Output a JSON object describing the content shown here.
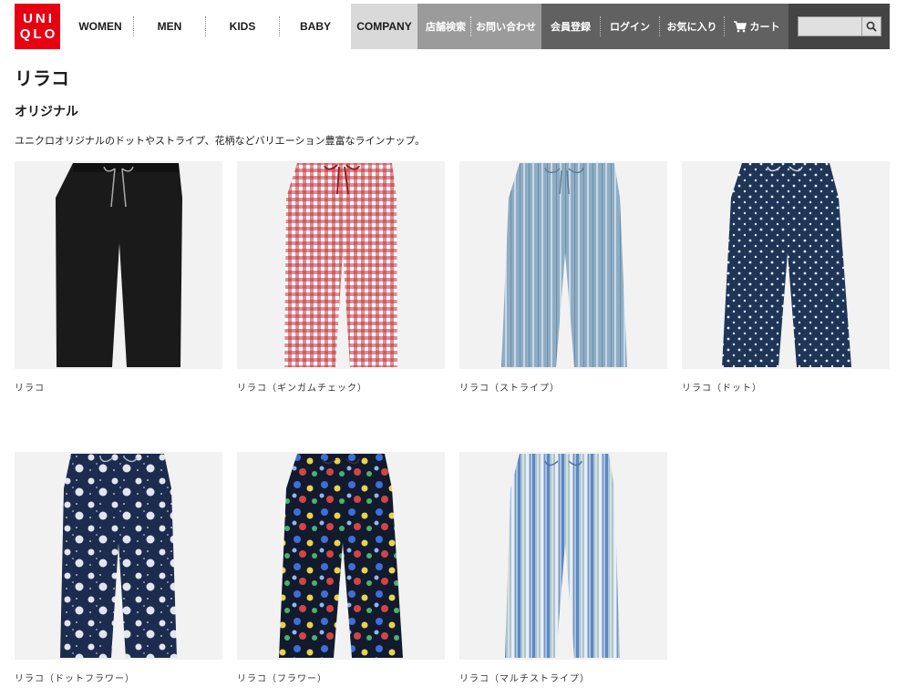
{
  "header": {
    "logo_line1": "UNI",
    "logo_line2": "QLO",
    "nav": {
      "women": "WOMEN",
      "men": "MEN",
      "kids": "KIDS",
      "baby": "BABY",
      "company": "COMPANY"
    },
    "store_search": "店舗検索",
    "contact": "お問い合わせ",
    "member_register": "会員登録",
    "login": "ログイン",
    "favorites": "お気に入り",
    "cart": "カート",
    "search": {
      "value": "",
      "placeholder": ""
    }
  },
  "page": {
    "title": "リラコ",
    "section_title": "オリジナル",
    "description": "ユニクロオリジナルのドットやストライプ、花柄などバリエーション豊富なラインナップ。"
  },
  "products": [
    {
      "name": "リラコ",
      "pattern": "plain-black"
    },
    {
      "name": "リラコ（ギンガムチェック）",
      "pattern": "gingham-red"
    },
    {
      "name": "リラコ（ストライプ）",
      "pattern": "stripe-blue"
    },
    {
      "name": "リラコ（ドット）",
      "pattern": "dot-navy"
    },
    {
      "name": "リラコ（ドットフラワー）",
      "pattern": "dotflower-navy"
    },
    {
      "name": "リラコ（フラワー）",
      "pattern": "flower-dark"
    },
    {
      "name": "リラコ（マルチストライプ）",
      "pattern": "multistripe"
    }
  ],
  "colors": {
    "brand_red": "#e60012",
    "company_bg": "#d9d9d9",
    "store_bg": "#9b9b9b",
    "member_bg": "#616161",
    "search_bg": "#444444"
  }
}
